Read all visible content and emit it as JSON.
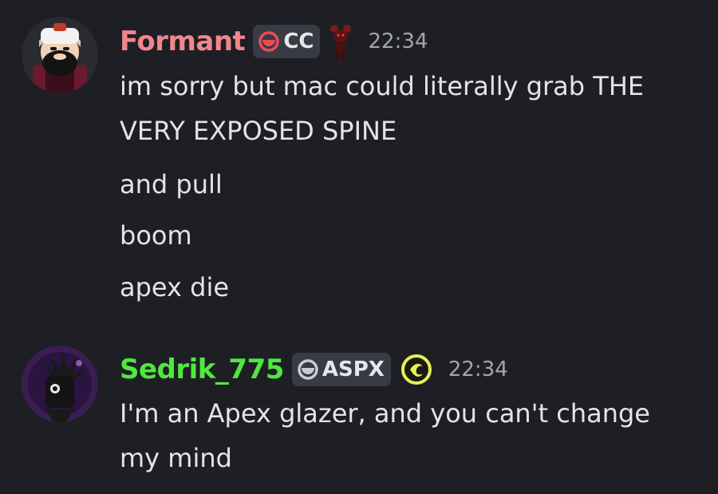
{
  "messages": [
    {
      "username": "Formant",
      "username_color": "#f0868c",
      "tag": "CC",
      "tag_icon_color": "#f04a58",
      "timestamp": "22:34",
      "lines": [
        "im sorry but mac could literally grab THE",
        "VERY EXPOSED SPINE",
        "and pull",
        "boom",
        "apex die"
      ]
    },
    {
      "username": "Sedrik_775",
      "username_color": "#4ee83e",
      "tag": "ASPX",
      "tag_icon_color": "#c9cbd0",
      "role_icon_color": "#e8ef5a",
      "timestamp": "22:34",
      "lines": [
        "I'm an Apex glazer, and you can't change",
        "my mind"
      ]
    }
  ]
}
